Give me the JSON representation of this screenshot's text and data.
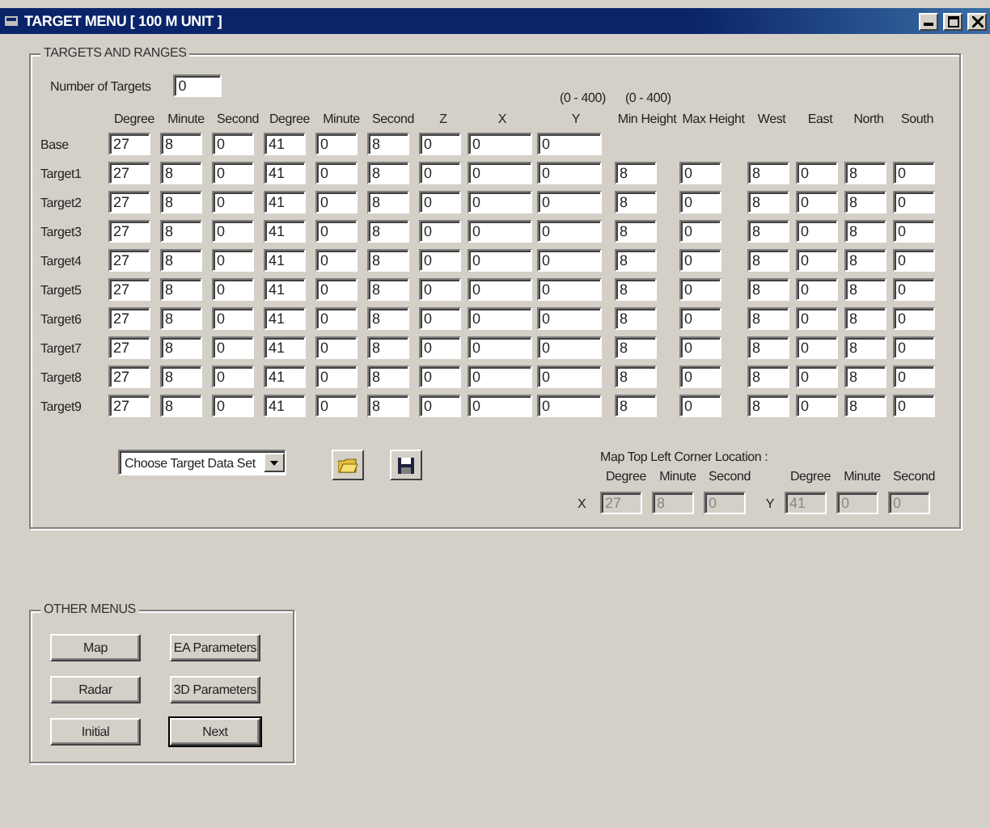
{
  "window": {
    "title": "TARGET MENU [ 100 M UNIT ]"
  },
  "targets_group": {
    "title": "TARGETS AND RANGES",
    "number_label": "Number of Targets",
    "number_value": "0",
    "ranges": [
      "(0 - 400)",
      "(0 - 400)"
    ],
    "columns": [
      "Degree",
      "Minute",
      "Second",
      "Degree",
      "Minute",
      "Second",
      "Z",
      "X",
      "Y",
      "Min Height",
      "Max Height",
      "West",
      "East",
      "North",
      "South"
    ],
    "rows": [
      {
        "label": "Base",
        "values": [
          "27",
          "8",
          "0",
          "41",
          "0",
          "8",
          "0",
          "0",
          "0"
        ]
      },
      {
        "label": "Target1",
        "values": [
          "27",
          "8",
          "0",
          "41",
          "0",
          "8",
          "0",
          "0",
          "0",
          "8",
          "0",
          "8",
          "0",
          "8",
          "0"
        ]
      },
      {
        "label": "Target2",
        "values": [
          "27",
          "8",
          "0",
          "41",
          "0",
          "8",
          "0",
          "0",
          "0",
          "8",
          "0",
          "8",
          "0",
          "8",
          "0"
        ]
      },
      {
        "label": "Target3",
        "values": [
          "27",
          "8",
          "0",
          "41",
          "0",
          "8",
          "0",
          "0",
          "0",
          "8",
          "0",
          "8",
          "0",
          "8",
          "0"
        ]
      },
      {
        "label": "Target4",
        "values": [
          "27",
          "8",
          "0",
          "41",
          "0",
          "8",
          "0",
          "0",
          "0",
          "8",
          "0",
          "8",
          "0",
          "8",
          "0"
        ]
      },
      {
        "label": "Target5",
        "values": [
          "27",
          "8",
          "0",
          "41",
          "0",
          "8",
          "0",
          "0",
          "0",
          "8",
          "0",
          "8",
          "0",
          "8",
          "0"
        ]
      },
      {
        "label": "Target6",
        "values": [
          "27",
          "8",
          "0",
          "41",
          "0",
          "8",
          "0",
          "0",
          "0",
          "8",
          "0",
          "8",
          "0",
          "8",
          "0"
        ]
      },
      {
        "label": "Target7",
        "values": [
          "27",
          "8",
          "0",
          "41",
          "0",
          "8",
          "0",
          "0",
          "0",
          "8",
          "0",
          "8",
          "0",
          "8",
          "0"
        ]
      },
      {
        "label": "Target8",
        "values": [
          "27",
          "8",
          "0",
          "41",
          "0",
          "8",
          "0",
          "0",
          "0",
          "8",
          "0",
          "8",
          "0",
          "8",
          "0"
        ]
      },
      {
        "label": "Target9",
        "values": [
          "27",
          "8",
          "0",
          "41",
          "0",
          "8",
          "0",
          "0",
          "0",
          "8",
          "0",
          "8",
          "0",
          "8",
          "0"
        ]
      }
    ],
    "data_set": {
      "value": "Choose Target Data Set"
    },
    "map_corner": {
      "title": "Map Top Left Corner Location :",
      "columns": [
        "Degree",
        "Minute",
        "Second",
        "Degree",
        "Minute",
        "Second"
      ],
      "x_label": "X",
      "y_label": "Y",
      "x_values": [
        "27",
        "8",
        "0"
      ],
      "y_values": [
        "41",
        "0",
        "0"
      ],
      "disabled": true
    }
  },
  "other_menus": {
    "title": "OTHER MENUS",
    "buttons": [
      {
        "label": "Map",
        "default": false
      },
      {
        "label": "EA Parameters",
        "default": false
      },
      {
        "label": "Radar",
        "default": false
      },
      {
        "label": "3D Parameters",
        "default": false
      },
      {
        "label": "Initial",
        "default": false
      },
      {
        "label": "Next",
        "default": true
      }
    ]
  }
}
